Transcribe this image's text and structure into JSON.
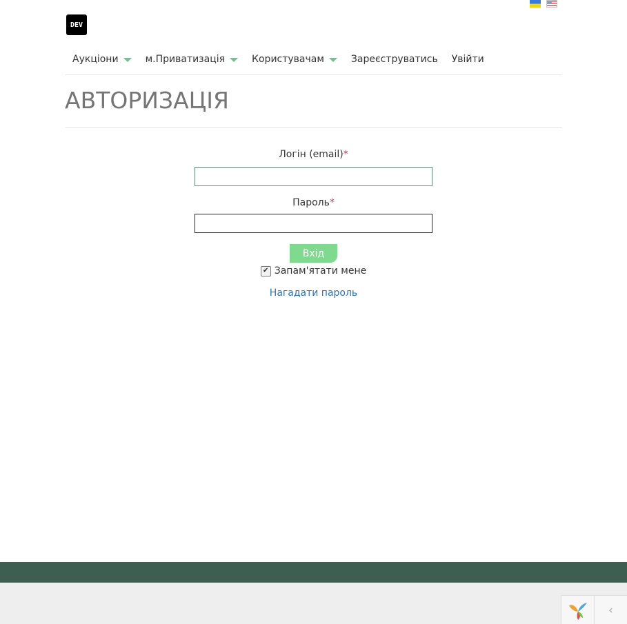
{
  "header": {
    "logo_text": "DEV",
    "languages": [
      {
        "code": "uk",
        "icon": "ukraine-flag-icon"
      },
      {
        "code": "en",
        "icon": "usa-flag-icon"
      }
    ]
  },
  "nav": {
    "items": [
      {
        "label": "Аукціони",
        "has_dropdown": true
      },
      {
        "label": "м.Приватизація",
        "has_dropdown": true
      },
      {
        "label": "Користувачам",
        "has_dropdown": true
      },
      {
        "label": "Зареєструватись",
        "has_dropdown": false
      },
      {
        "label": "Увійти",
        "has_dropdown": false
      }
    ]
  },
  "page": {
    "title": "АВТОРИЗАЦІЯ"
  },
  "form": {
    "login_label": "Логін (email)",
    "password_label": "Пароль",
    "required_mark": "*",
    "login_value": "",
    "password_value": "",
    "submit_label": "Вхід",
    "remember_label": "Запам'ятати мене",
    "remember_checked": true,
    "forgot_label": "Нагадати пароль"
  },
  "colors": {
    "accent": "#7dbb97",
    "submit_bg": "#7fd98f",
    "footer_band": "#3d5e50",
    "link": "#2a73b0",
    "required": "#d9303e"
  },
  "debug_toolbar": {
    "logo_icon": "yii-logo-icon",
    "toggle_icon": "chevron-left-icon",
    "toggle_glyph": "‹"
  }
}
